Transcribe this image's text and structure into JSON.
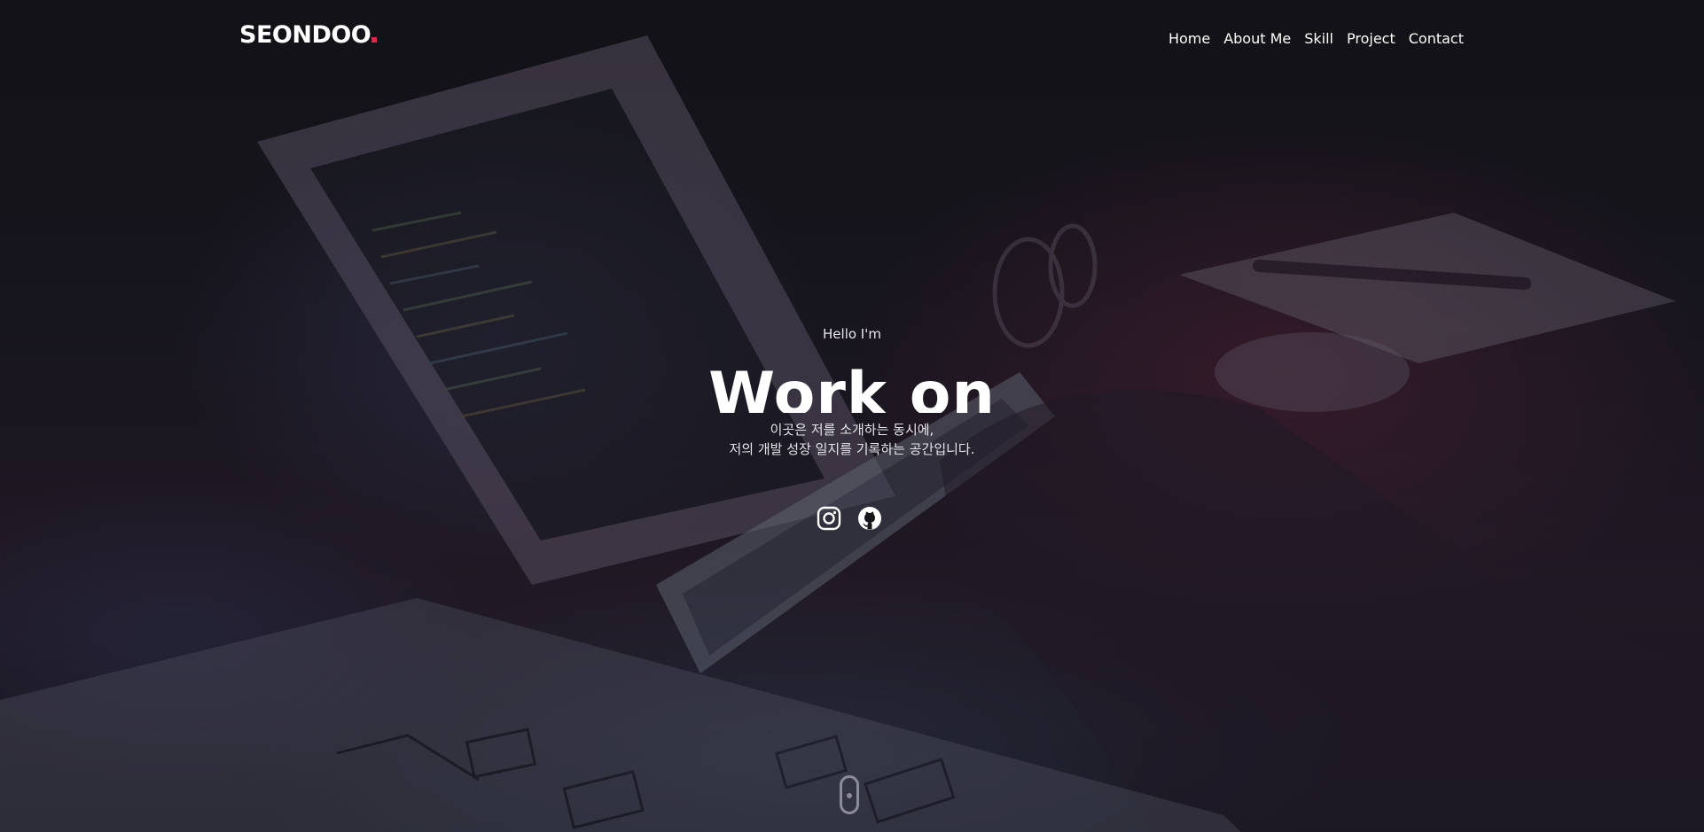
{
  "nav": {
    "logo": "SEONDOO",
    "accent_color": "#e8234a",
    "items": [
      {
        "label": "Home"
      },
      {
        "label": "About Me"
      },
      {
        "label": "Skill"
      },
      {
        "label": "Project"
      },
      {
        "label": "Contact"
      }
    ]
  },
  "hero": {
    "greeting": "Hello I'm",
    "headline": "Work on",
    "intro_line1": "이곳은 저를 소개하는 동시에,",
    "intro_line2": "저의 개발 성장 일지를 기록하는 공간입니다.",
    "socials": [
      {
        "icon": "instagram-icon"
      },
      {
        "icon": "github-icon"
      }
    ]
  }
}
